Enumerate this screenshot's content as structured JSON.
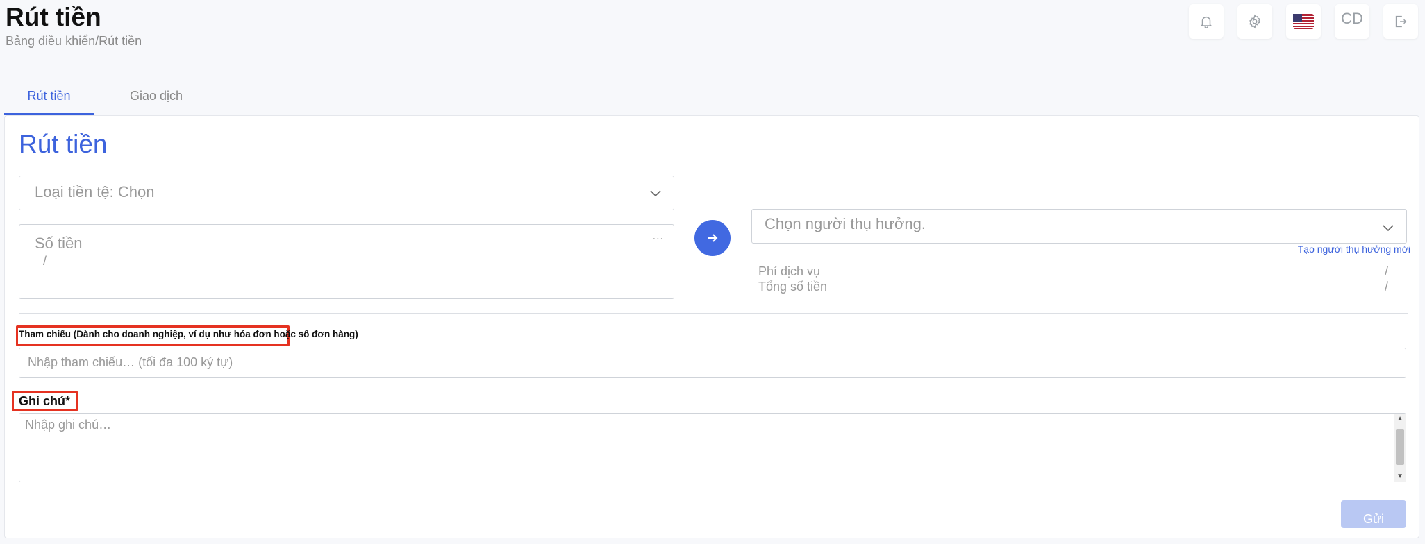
{
  "header": {
    "title": "Rút tiền",
    "breadcrumb": "Bảng điều khiển/Rút tiền",
    "user_initials": "CD"
  },
  "tabs": [
    {
      "label": "Rút tiền",
      "active": true
    },
    {
      "label": "Giao dịch",
      "active": false
    }
  ],
  "form": {
    "title": "Rút tiền",
    "currency_select": "Loại tiền tệ: Chọn",
    "amount_placeholder": "Số tiền",
    "amount_currency": "/",
    "amount_menu": "...",
    "beneficiary_select": "Chọn người thụ hưởng.",
    "create_beneficiary_link": "Tạo người thụ hưởng mới",
    "service_fee_label": "Phí dịch vụ",
    "service_fee_value": "/",
    "total_label": "Tổng số tiền",
    "total_value": "/",
    "reference_label": "Tham chiếu (Dành cho doanh nghiệp, ví dụ như hóa đơn hoặc số đơn hàng)",
    "reference_placeholder": "Nhập tham chiếu… (tối đa 100 ký tự)",
    "note_label": "Ghi chú*",
    "note_placeholder": "Nhập ghi chú…",
    "submit_label": "Gửi"
  },
  "icons": {
    "notifications": "bell-icon",
    "settings": "gear-icon",
    "language": "us-flag-icon",
    "logout": "logout-icon",
    "submit_arrow": "arrow-right-icon"
  },
  "colors": {
    "accent": "#3d63dd",
    "highlight_box": "#e53221",
    "submit_disabled": "#b9c8f3"
  }
}
